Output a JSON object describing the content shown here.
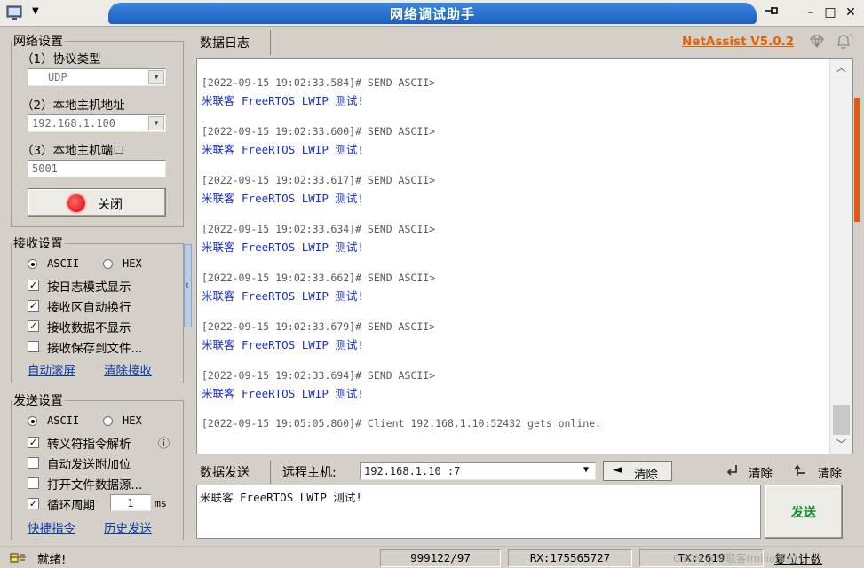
{
  "window": {
    "title": "网络调试助手",
    "pin_icon": "pin-icon",
    "minimize": "–",
    "maximize": "□",
    "close": "✕"
  },
  "net": {
    "legend": "网络设置",
    "protocol_label": "（1）协议类型",
    "protocol_value": "UDP",
    "host_label": "（2）本地主机地址",
    "host_value": "192.168.1.100",
    "port_label": "（3）本地主机端口",
    "port_value": "5001",
    "close_button": "关闭"
  },
  "recv": {
    "legend": "接收设置",
    "ascii": "ASCII",
    "hex": "HEX",
    "opt1": "按日志模式显示",
    "opt2": "接收区自动换行",
    "opt3": "接收数据不显示",
    "opt4": "接收保存到文件...",
    "link1": "自动滚屏",
    "link2": "清除接收"
  },
  "send": {
    "legend": "发送设置",
    "ascii": "ASCII",
    "hex": "HEX",
    "opt1": "转义符指令解析",
    "opt2": "自动发送附加位",
    "opt3": "打开文件数据源...",
    "opt4": "循环周期",
    "period_value": "1",
    "period_unit": "ms",
    "link1": "快捷指令",
    "link2": "历史发送",
    "info_icon": "ⓘ"
  },
  "log": {
    "tab": "数据日志",
    "brand": "NetAssist V5.0.2",
    "entries": [
      {
        "stamp": "[2022-09-15 19:02:33.584]# SEND ASCII>",
        "msg": "米联客 FreeRTOS LWIP 测试!"
      },
      {
        "stamp": "[2022-09-15 19:02:33.600]# SEND ASCII>",
        "msg": "米联客 FreeRTOS LWIP 测试!"
      },
      {
        "stamp": "[2022-09-15 19:02:33.617]# SEND ASCII>",
        "msg": "米联客 FreeRTOS LWIP 测试!"
      },
      {
        "stamp": "[2022-09-15 19:02:33.634]# SEND ASCII>",
        "msg": "米联客 FreeRTOS LWIP 测试!"
      },
      {
        "stamp": "[2022-09-15 19:02:33.662]# SEND ASCII>",
        "msg": "米联客 FreeRTOS LWIP 测试!"
      },
      {
        "stamp": "[2022-09-15 19:02:33.679]# SEND ASCII>",
        "msg": "米联客 FreeRTOS LWIP 测试!"
      },
      {
        "stamp": "[2022-09-15 19:02:33.694]# SEND ASCII>",
        "msg": "米联客 FreeRTOS LWIP 测试!"
      }
    ],
    "online": "[2022-09-15 19:05:05.860]# Client 192.168.1.10:52432 gets online."
  },
  "sendbar": {
    "tab": "数据发送",
    "remote_label": "远程主机:",
    "remote_value": "192.168.1.10 :7",
    "clear1": "清除",
    "clear2": "清除",
    "clear3": "清除",
    "input_value": "米联客 FreeRTOS LWIP 测试!",
    "send_button": "发送"
  },
  "status": {
    "ready": "就绪!",
    "count": "999122/97",
    "rx": "RX:175565727",
    "tx": "TX:2619",
    "reset": "复位计数",
    "watermark": "CSDN @米联客(milianke)"
  }
}
